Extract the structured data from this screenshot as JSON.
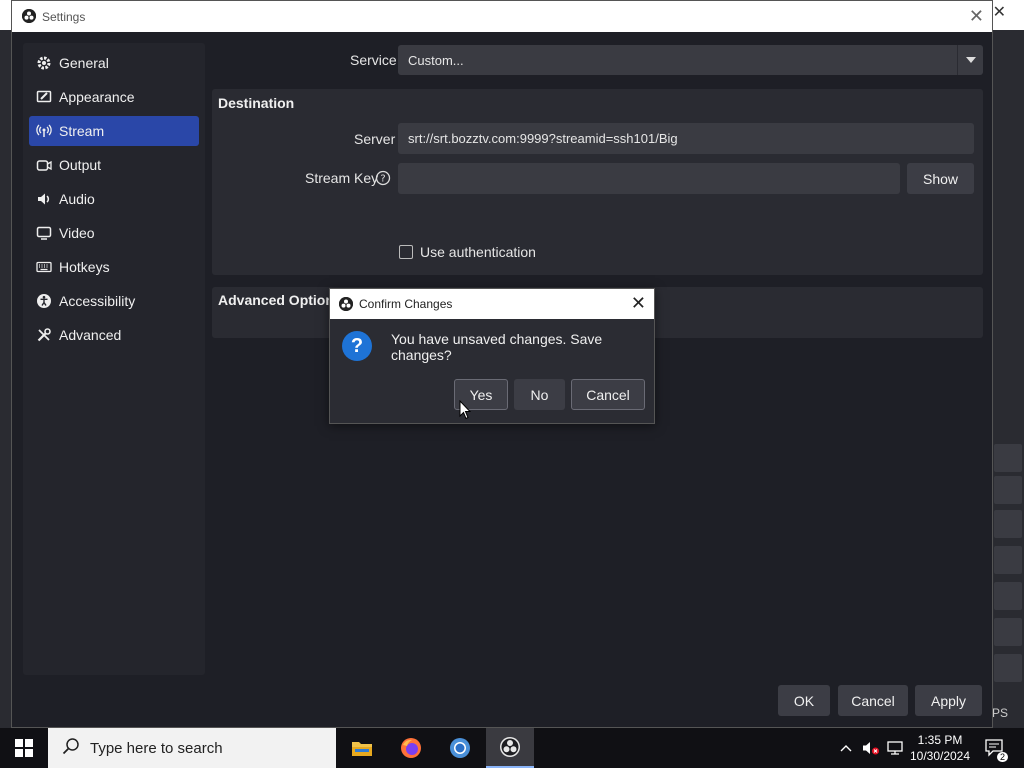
{
  "background_window": {
    "close_glyph": "✕",
    "right_strip_text": "PS"
  },
  "settings": {
    "title": "Settings",
    "close_glyph": "✕",
    "sidebar": {
      "items": [
        {
          "label": "General",
          "icon": "gear-icon"
        },
        {
          "label": "Appearance",
          "icon": "appearance-icon"
        },
        {
          "label": "Stream",
          "icon": "broadcast-icon"
        },
        {
          "label": "Output",
          "icon": "output-icon"
        },
        {
          "label": "Audio",
          "icon": "speaker-icon"
        },
        {
          "label": "Video",
          "icon": "monitor-icon"
        },
        {
          "label": "Hotkeys",
          "icon": "keyboard-icon"
        },
        {
          "label": "Accessibility",
          "icon": "accessibility-icon"
        },
        {
          "label": "Advanced",
          "icon": "tools-icon"
        }
      ],
      "active": "Stream"
    },
    "service": {
      "label": "Service",
      "value": "Custom..."
    },
    "destination": {
      "title": "Destination",
      "server_label": "Server",
      "server_value": "srt://srt.bozztv.com:9999?streamid=ssh101/Big",
      "stream_key_label": "Stream Key",
      "stream_key_value": "",
      "show_label": "Show",
      "use_auth_label": "Use authentication",
      "use_auth_checked": false
    },
    "advanced_options": {
      "title": "Advanced Option"
    },
    "footer": {
      "ok": "OK",
      "cancel": "Cancel",
      "apply": "Apply"
    }
  },
  "dialog": {
    "title": "Confirm Changes",
    "message": "You have unsaved changes. Save changes?",
    "icon_glyph": "?",
    "yes": "Yes",
    "no": "No",
    "cancel": "Cancel"
  },
  "taskbar": {
    "search_placeholder": "Type here to search",
    "apps": [
      "file-explorer-icon",
      "firefox-icon",
      "chrome-icon",
      "obs-icon"
    ],
    "clock_time": "1:35 PM",
    "clock_date": "10/30/2024",
    "notification_count": "2"
  },
  "colors": {
    "accent": "#2a47a8",
    "panel": "#2a2b32",
    "window_bg": "#1e1f26",
    "input_bg": "#3a3b42",
    "dialog_icon": "#1e73d6"
  }
}
